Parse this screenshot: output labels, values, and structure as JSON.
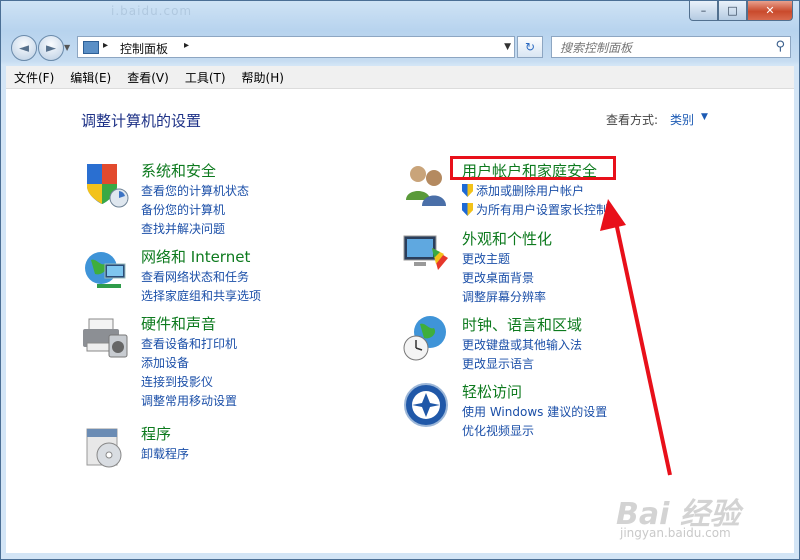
{
  "window": {
    "blurred_title": "i.baidu.com",
    "min_label": "–",
    "max_label": "□",
    "close_label": "✕"
  },
  "nav": {
    "back_glyph": "◄",
    "forward_glyph": "►",
    "address_crumb": "控制面板",
    "crumb_sep": "▸",
    "search_placeholder": "搜索控制面板"
  },
  "menu": [
    "文件(F)",
    "编辑(E)",
    "查看(V)",
    "工具(T)",
    "帮助(H)"
  ],
  "page": {
    "title": "调整计算机的设置",
    "view_by_label": "查看方式:",
    "view_by_value": "类别"
  },
  "categories": {
    "system": {
      "title": "系统和安全",
      "links": [
        "查看您的计算机状态",
        "备份您的计算机",
        "查找并解决问题"
      ]
    },
    "network": {
      "title": "网络和 Internet",
      "links": [
        "查看网络状态和任务",
        "选择家庭组和共享选项"
      ]
    },
    "hardware": {
      "title": "硬件和声音",
      "links": [
        "查看设备和打印机",
        "添加设备",
        "连接到投影仪",
        "调整常用移动设置"
      ]
    },
    "programs": {
      "title": "程序",
      "links": [
        "卸载程序"
      ]
    },
    "users": {
      "title": "用户帐户和家庭安全",
      "links": [
        "添加或删除用户帐户",
        "为所有用户设置家长控制"
      ]
    },
    "appearance": {
      "title": "外观和个性化",
      "links": [
        "更改主题",
        "更改桌面背景",
        "调整屏幕分辨率"
      ]
    },
    "clock": {
      "title": "时钟、语言和区域",
      "links": [
        "更改键盘或其他输入法",
        "更改显示语言"
      ]
    },
    "access": {
      "title": "轻松访问",
      "links": [
        "使用 Windows 建议的设置",
        "优化视频显示"
      ]
    }
  },
  "colors": {
    "highlight": "#e8101a",
    "category_title": "#0d7a1e",
    "link": "#1b4fa8",
    "page_title": "#1e3287"
  },
  "watermark": {
    "brand": "Bai 经验",
    "url": "jingyan.baidu.com"
  }
}
